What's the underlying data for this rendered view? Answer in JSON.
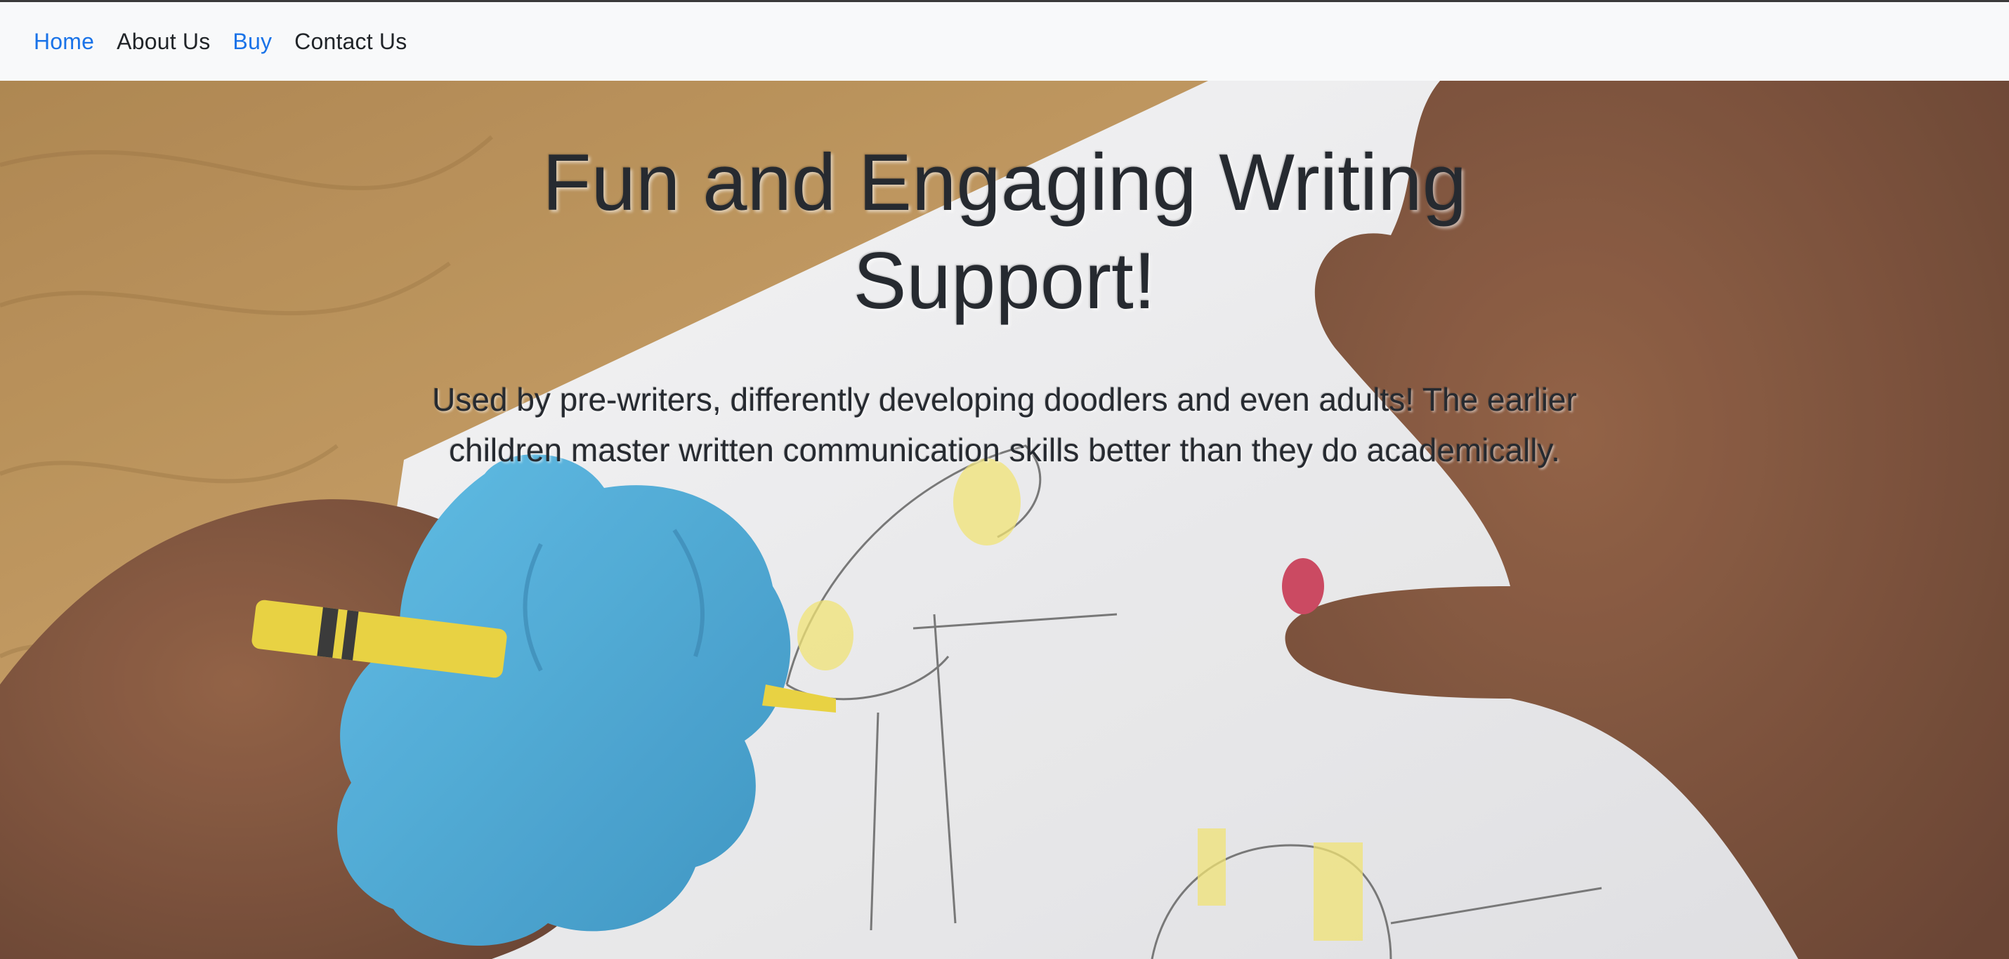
{
  "nav": {
    "links": [
      {
        "label": "Home",
        "active": true
      },
      {
        "label": "About Us",
        "active": false
      },
      {
        "label": "Buy",
        "active": true
      },
      {
        "label": "Contact Us",
        "active": false
      }
    ]
  },
  "hero": {
    "title": "Fun and Engaging Writing Support!",
    "subtitle": "Used by pre-writers, differently developing doodlers and even adults! The earlier children master written communication skills better than they do academically."
  },
  "colors": {
    "nav_background": "#f8f9fa",
    "active_link": "#1a73e8",
    "text": "#212529",
    "wood": "#b88a4a",
    "paper": "#f2f2f3",
    "skin": "#7a4a33",
    "grip_blue": "#3fa3d1",
    "crayon_yellow": "#e9d33a"
  },
  "icons": {
    "hero_image": "child-hand-drawing-with-blue-grip-and-crayon-photo"
  }
}
